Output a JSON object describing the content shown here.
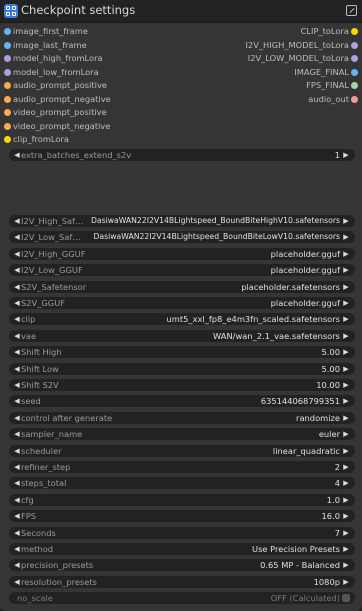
{
  "node": {
    "title": "Checkpoint settings"
  },
  "inputs": [
    {
      "label": "image_first_frame",
      "color": "#64b5f6"
    },
    {
      "label": "image_last_frame",
      "color": "#64b5f6"
    },
    {
      "label": "model_high_fromLora",
      "color": "#b39ddb"
    },
    {
      "label": "model_low_fromLora",
      "color": "#b39ddb"
    },
    {
      "label": "audio_prompt_positive",
      "color": "#ffa94d"
    },
    {
      "label": "audio_prompt_negative",
      "color": "#ffa94d"
    },
    {
      "label": "video_prompt_positive",
      "color": "#ffa94d"
    },
    {
      "label": "video_prompt_negative",
      "color": "#ffa94d"
    },
    {
      "label": "clip_fromLora",
      "color": "#ffd500"
    }
  ],
  "outputs": [
    {
      "label": "CLIP_toLora",
      "color": "#ffd500"
    },
    {
      "label": "I2V_HIGH_MODEL_toLora",
      "color": "#b39ddb"
    },
    {
      "label": "I2V_LOW_MODEL_toLora",
      "color": "#b39ddb"
    },
    {
      "label": "IMAGE_FINAL",
      "color": "#64b5f6"
    },
    {
      "label": "FPS_FINAL",
      "color": "#a5d6a7"
    },
    {
      "label": "audio_out",
      "color": "#ef9a9a"
    }
  ],
  "widgets": [
    {
      "name": "extra_batches_extend_s2v",
      "value": "1",
      "dim": false
    },
    {
      "name": "I2V_High_Saf…",
      "value": "DasiwaWAN22I2V14BLightspeed_BoundBiteHighV10.safetensors",
      "dim": false
    },
    {
      "name": "I2V_Low_Saf…",
      "value": "DasiwaWAN22I2V14BLightspeed_BoundBiteLowV10.safetensors",
      "dim": false
    },
    {
      "name": "I2V_High_GGUF",
      "value": "placeholder.gguf",
      "dim": false
    },
    {
      "name": "I2V_Low_GGUF",
      "value": "placeholder.gguf",
      "dim": false
    },
    {
      "name": "S2V_Safetensor",
      "value": "placeholder.safetensors",
      "dim": false
    },
    {
      "name": "S2V_GGUF",
      "value": "placeholder.gguf",
      "dim": false
    },
    {
      "name": "clip",
      "value": "umt5_xxl_fp8_e4m3fn_scaled.safetensors",
      "dim": false
    },
    {
      "name": "vae",
      "value": "WAN/wan_2.1_vae.safetensors",
      "dim": false
    },
    {
      "name": "Shift High",
      "value": "5.00",
      "dim": false
    },
    {
      "name": "Shift Low",
      "value": "5.00",
      "dim": false
    },
    {
      "name": "Shift S2V",
      "value": "10.00",
      "dim": false
    },
    {
      "name": "seed",
      "value": "635144068799351",
      "dim": false
    },
    {
      "name": "control after generate",
      "value": "randomize",
      "dim": false
    },
    {
      "name": "sampler_name",
      "value": "euler",
      "dim": false
    },
    {
      "name": "scheduler",
      "value": "linear_quadratic",
      "dim": false
    },
    {
      "name": "refiner_step",
      "value": "2",
      "dim": false
    },
    {
      "name": "steps_total",
      "value": "4",
      "dim": false
    },
    {
      "name": "cfg",
      "value": "1.0",
      "dim": false
    },
    {
      "name": "FPS",
      "value": "16.0",
      "dim": false
    },
    {
      "name": "Seconds",
      "value": "7",
      "dim": false
    },
    {
      "name": "method",
      "value": "Use Precision Presets",
      "dim": false
    },
    {
      "name": "precision_presets",
      "value": "0.65 MP - Balanced",
      "dim": false
    },
    {
      "name": "resolution_presets",
      "value": "1080p",
      "dim": false
    },
    {
      "name": "no_scale",
      "value": "OFF (Calculated)",
      "dim": true
    }
  ],
  "glyphs": {
    "left": "◀",
    "right": "▶"
  }
}
